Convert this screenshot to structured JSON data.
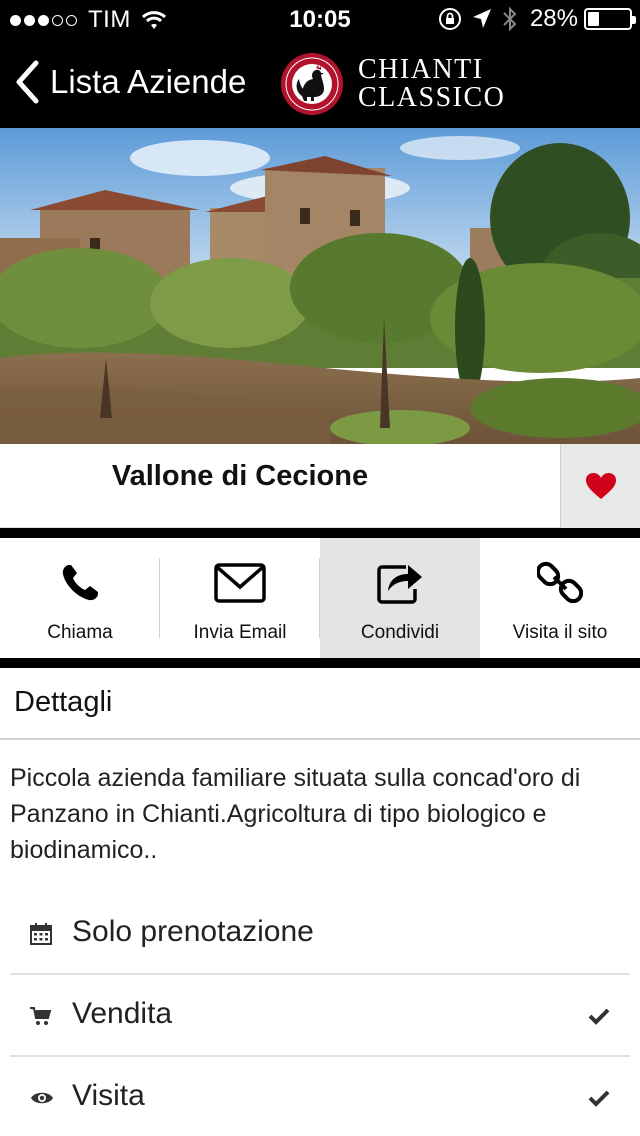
{
  "status_bar": {
    "carrier": "TIM",
    "time": "10:05",
    "battery_pct": "28%",
    "battery_level": 0.28,
    "signal_bars_filled": 3,
    "signal_bars_total": 5
  },
  "nav": {
    "back_label": "Lista Aziende",
    "brand_line1": "CHIANTI",
    "brand_line2": "CLASSICO",
    "seal_text": "CHIANTI CLASSICO",
    "seal_subtext": "DAL 1716"
  },
  "winery": {
    "name": "Vallone di Cecione",
    "favorite": true
  },
  "actions": [
    {
      "label": "Chiama",
      "icon": "phone-icon"
    },
    {
      "label": "Invia Email",
      "icon": "envelope-icon"
    },
    {
      "label": "Condividi",
      "icon": "share-icon",
      "active": true
    },
    {
      "label": "Visita il sito",
      "icon": "link-icon"
    }
  ],
  "details": {
    "heading": "Dettagli",
    "description": "Piccola azienda familiare situata sulla concad'oro di Panzano in Chianti.Agricoltura di tipo biologico e biodinamico.."
  },
  "features": [
    {
      "label": "Solo prenotazione",
      "icon": "calendar-icon",
      "checked": false
    },
    {
      "label": "Vendita",
      "icon": "cart-icon",
      "checked": true
    },
    {
      "label": "Visita",
      "icon": "eye-icon",
      "checked": true
    }
  ],
  "colors": {
    "bar_background": "#000000",
    "favorite_heart": "#d0021b",
    "active_action_background": "#e4e4e4",
    "seal_red": "#b3122d"
  }
}
